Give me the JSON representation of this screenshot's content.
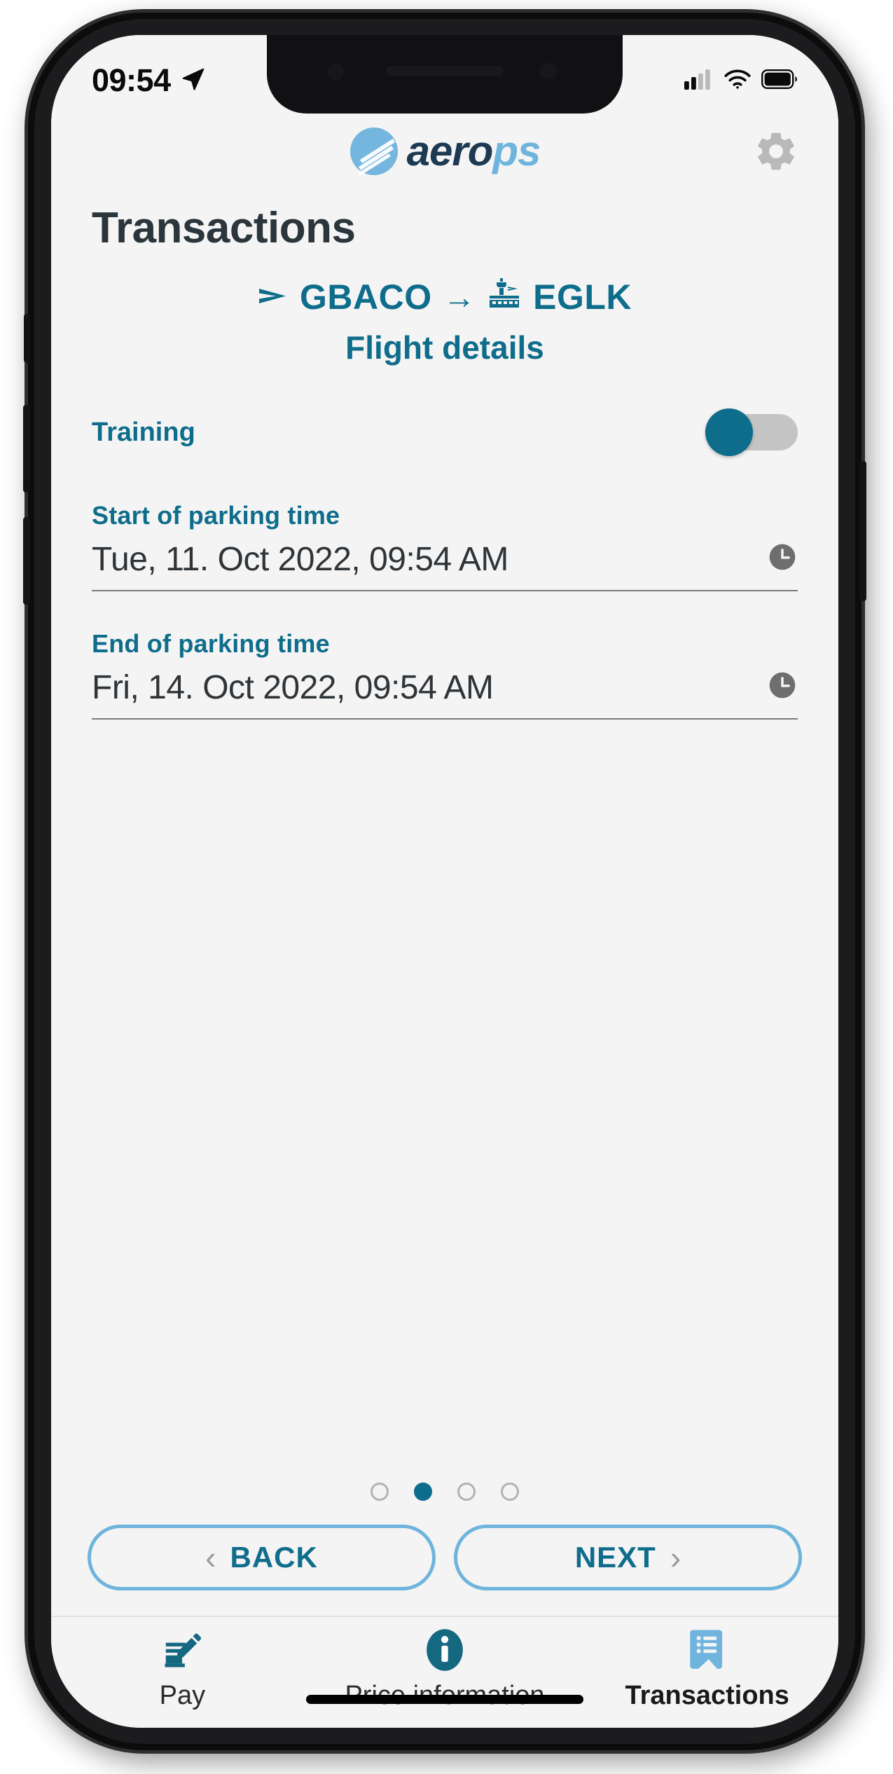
{
  "status_bar": {
    "time": "09:54",
    "location_icon": "location-arrow-icon",
    "signal_icon": "cellular-signal-icon",
    "wifi_icon": "wifi-icon",
    "battery_icon": "battery-full-icon"
  },
  "header": {
    "logo_text_primary": "aero",
    "logo_text_secondary": "ps",
    "logo_mark": "globe-stripes-icon",
    "settings_icon": "gear-icon"
  },
  "page": {
    "title": "Transactions"
  },
  "route": {
    "departure_icon": "plane-departure-icon",
    "departure": "GBACO",
    "separator": "→",
    "arrival_icon": "control-tower-icon",
    "arrival": "EGLK",
    "subtitle": "Flight details"
  },
  "form": {
    "training": {
      "label": "Training",
      "value": "off"
    },
    "start_parking": {
      "label": "Start of parking time",
      "value": "Tue, 11. Oct 2022, 09:54 AM",
      "icon": "clock-icon"
    },
    "end_parking": {
      "label": "End of parking time",
      "value": "Fri, 14. Oct 2022, 09:54 AM",
      "icon": "clock-icon"
    }
  },
  "pagination": {
    "total": 4,
    "active_index": 1
  },
  "nav": {
    "back_label": "BACK",
    "back_chevron": "chevron-left-icon",
    "next_label": "NEXT",
    "next_chevron": "chevron-right-icon"
  },
  "tabbar": {
    "tabs": [
      {
        "label": "Pay",
        "icon": "sign-document-icon",
        "active": false
      },
      {
        "label": "Price information",
        "icon": "info-circle-icon",
        "active": false
      },
      {
        "label": "Transactions",
        "icon": "receipt-icon",
        "active": true
      }
    ]
  },
  "colors": {
    "teal": "#0f6d8c",
    "light_blue": "#6fb4dc",
    "dark_navy": "#1e3a52",
    "title_slate": "#2b353c",
    "screen_bg": "#f4f4f4",
    "toggle_track": "#c4c4c4",
    "clock_gray": "#6e6e6e"
  }
}
